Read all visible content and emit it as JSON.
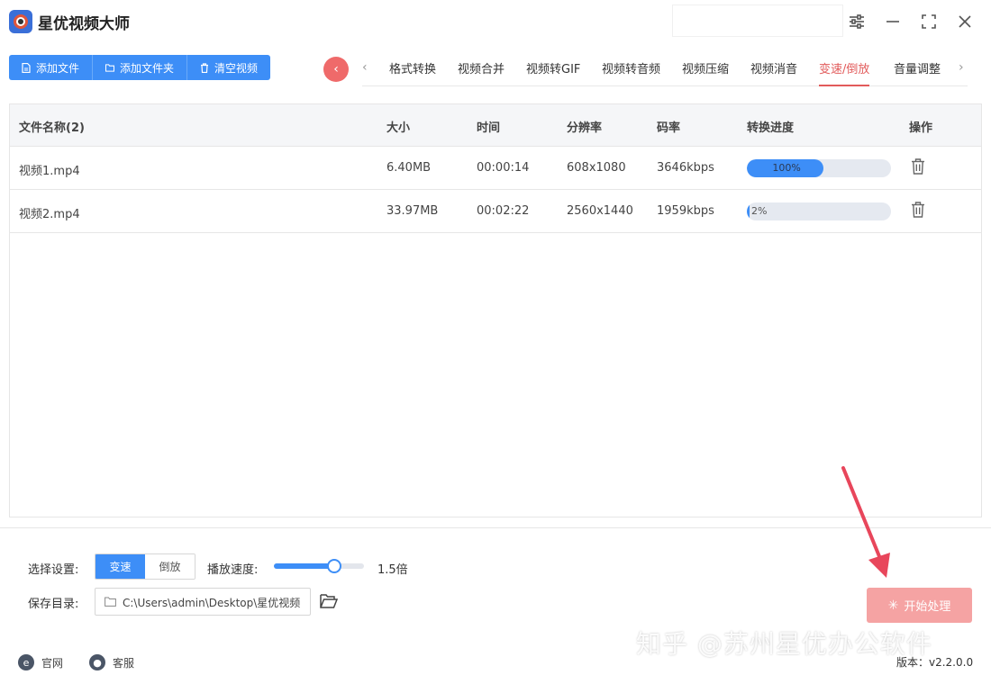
{
  "app": {
    "title": "星优视频大师"
  },
  "toolbar": {
    "add_file": "添加文件",
    "add_folder": "添加文件夹",
    "clear": "清空视频"
  },
  "tabs": [
    {
      "label": "格式转换",
      "active": false
    },
    {
      "label": "视频合并",
      "active": false
    },
    {
      "label": "视频转GIF",
      "active": false
    },
    {
      "label": "视频转音频",
      "active": false
    },
    {
      "label": "视频压缩",
      "active": false
    },
    {
      "label": "视频消音",
      "active": false
    },
    {
      "label": "变速/倒放",
      "active": true
    },
    {
      "label": "音量调整",
      "active": false
    }
  ],
  "table": {
    "headers": {
      "name": "文件名称(2)",
      "size": "大小",
      "time": "时间",
      "resolution": "分辨率",
      "bitrate": "码率",
      "progress": "转换进度",
      "action": "操作"
    },
    "rows": [
      {
        "name": "视频1.mp4",
        "size": "6.40MB",
        "time": "00:00:14",
        "resolution": "608x1080",
        "bitrate": "3646kbps",
        "progress": 100,
        "progress_label": "100%"
      },
      {
        "name": "视频2.mp4",
        "size": "33.97MB",
        "time": "00:02:22",
        "resolution": "2560x1440",
        "bitrate": "1959kbps",
        "progress": 2,
        "progress_label": "2%"
      }
    ]
  },
  "settings": {
    "mode_label": "选择设置:",
    "mode_options": [
      "变速",
      "倒放"
    ],
    "mode_selected": "变速",
    "speed_label": "播放速度:",
    "speed_value": "1.5倍",
    "speed_fraction": 0.67,
    "save_label": "保存目录:",
    "save_path": "C:\\Users\\admin\\Desktop\\星优视频",
    "start_button": "开始处理"
  },
  "status": {
    "website": "官网",
    "service": "客服",
    "version": "版本：v2.2.0.0"
  },
  "watermark": "知乎 @苏州星优办公软件",
  "colors": {
    "primary": "#3d8ef7",
    "accent_red": "#e25b5b",
    "start_button": "#f5a3a3"
  }
}
